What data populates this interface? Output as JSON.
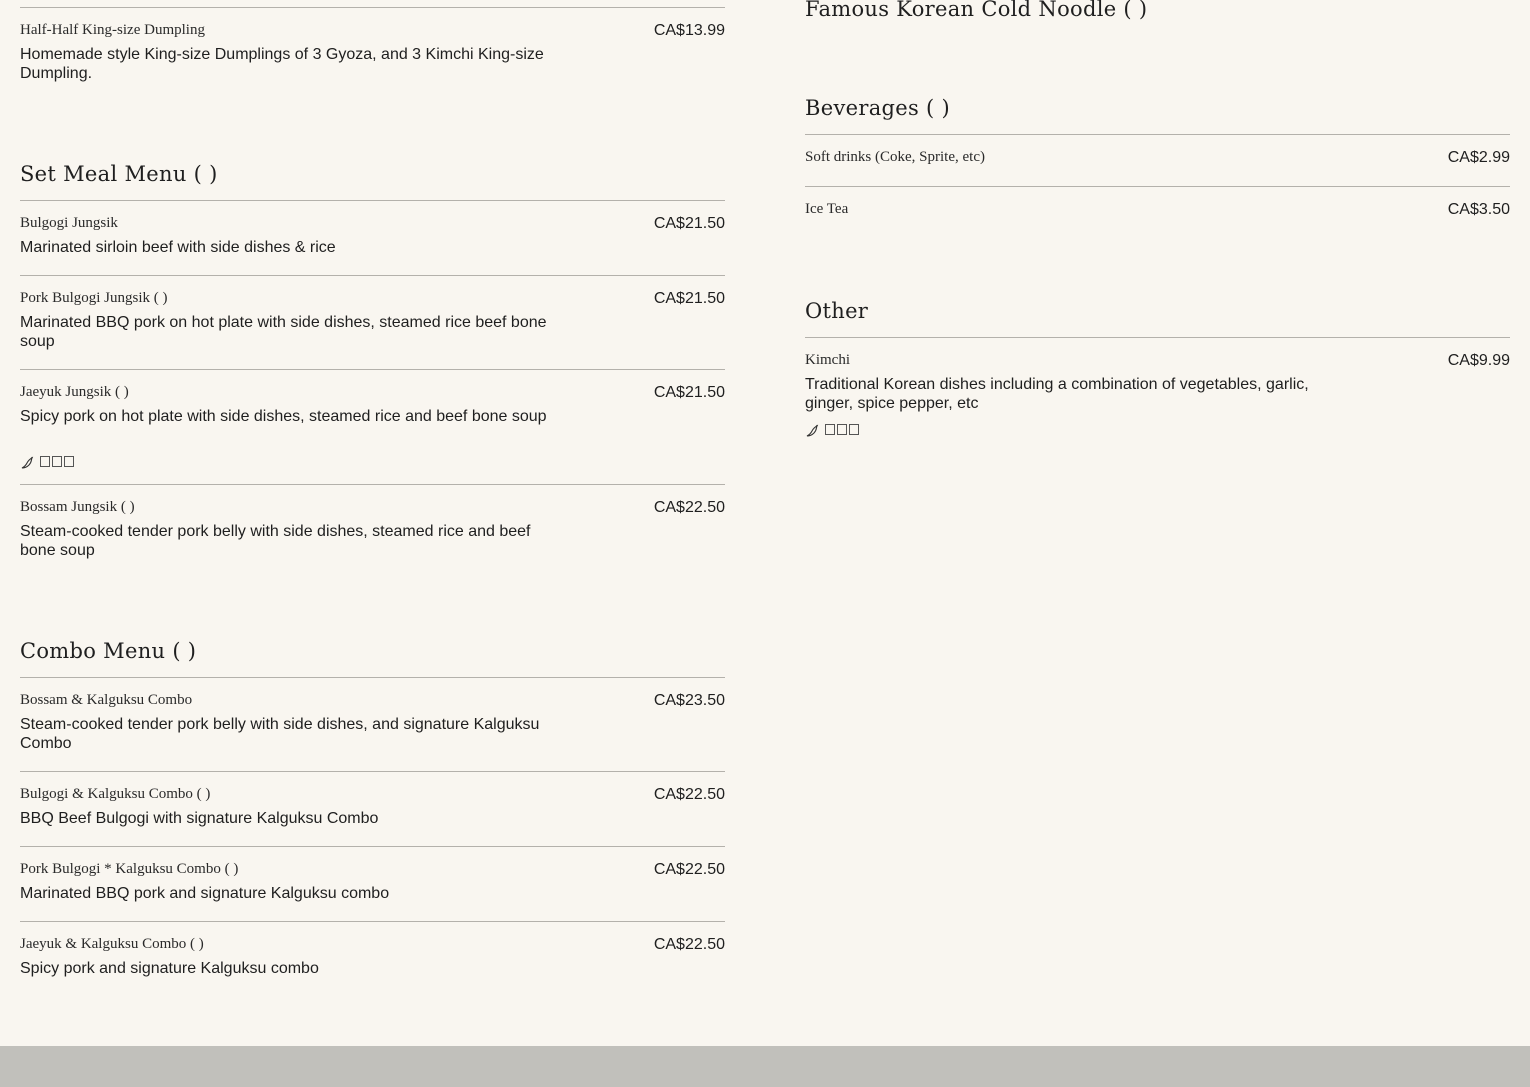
{
  "left": {
    "top_item": {
      "name": "Half-Half King-size Dumpling",
      "price": "CA$13.99",
      "description": "Homemade style King-size Dumplings of 3 Gyoza, and 3 Kimchi King-size Dumpling."
    },
    "set_meal": {
      "title": "Set Meal Menu (      )",
      "items": [
        {
          "name": "Bulgogi Jungsik",
          "price": "CA$21.50",
          "description": "Marinated sirloin beef with side dishes & rice"
        },
        {
          "name": "Pork Bulgogi Jungsik (         )",
          "price": "CA$21.50",
          "description": "Marinated BBQ pork on hot plate with side dishes, steamed rice beef bone soup"
        },
        {
          "name": "Jaeyuk Jungsik (       )",
          "price": "CA$21.50",
          "description": "Spicy pork on hot plate with side dishes, steamed rice and beef bone soup",
          "tag_icon": "chili-icon"
        },
        {
          "name": "Bossam Jungsik (     )",
          "price": "CA$22.50",
          "description": "Steam-cooked tender pork belly with side dishes, steamed rice and beef bone soup"
        }
      ]
    },
    "combo": {
      "title": "Combo Menu (      )",
      "items": [
        {
          "name": "Bossam & Kalguksu Combo",
          "price": "CA$23.50",
          "description": "Steam-cooked tender pork belly with side dishes, and signature Kalguksu Combo"
        },
        {
          "name": "Bulgogi & Kalguksu Combo (       )",
          "price": "CA$22.50",
          "description": "BBQ Beef Bulgogi with signature Kalguksu Combo"
        },
        {
          "name": "Pork Bulgogi * Kalguksu Combo (         )",
          "price": "CA$22.50",
          "description": "Marinated BBQ pork and signature Kalguksu combo"
        },
        {
          "name": "Jaeyuk & Kalguksu Combo (        )",
          "price": "CA$22.50",
          "description": "Spicy pork and signature Kalguksu combo"
        }
      ]
    }
  },
  "right": {
    "noodle_title": "Famous Korean Cold Noodle (        )",
    "beverages": {
      "title": "Beverages (        )",
      "items": [
        {
          "name": "Soft drinks (Coke, Sprite, etc)",
          "price": "CA$2.99"
        },
        {
          "name": "Ice Tea",
          "price": "CA$3.50"
        }
      ]
    },
    "other": {
      "title": "Other",
      "items": [
        {
          "name": "Kimchi",
          "price": "CA$9.99",
          "description": "Traditional Korean dishes including a combination of vegetables, garlic, ginger, spice pepper, etc",
          "tag_icon": "chili-icon"
        }
      ]
    }
  },
  "colors": {
    "background": "#f9f6f0",
    "divider": "#b4b1ab",
    "footer": "#c1c0bb",
    "text": "#1c1c1c"
  }
}
